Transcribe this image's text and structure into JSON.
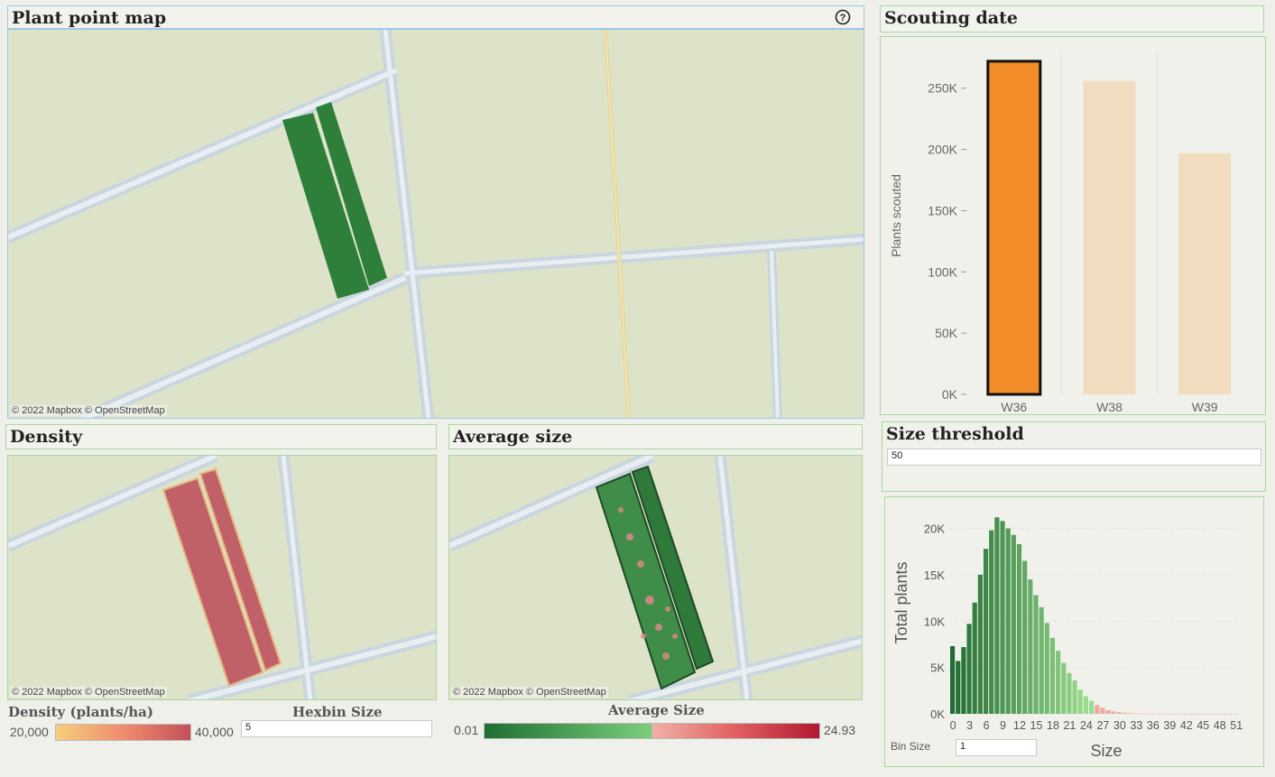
{
  "plant_map": {
    "title": "Plant point map",
    "help_icon": "question-circle-icon",
    "credit": "© 2022 Mapbox © OpenStreetMap"
  },
  "density": {
    "title": "Density",
    "credit": "© 2022 Mapbox © OpenStreetMap",
    "legend_title": "Density (plants/ha)",
    "legend_min": "20,000",
    "legend_max": "40,000",
    "hexbin_label": "Hexbin Size",
    "hexbin_value": "5"
  },
  "average_size": {
    "title": "Average size",
    "credit": "© 2022 Mapbox © OpenStreetMap",
    "legend_title": "Average Size",
    "legend_min": "0.01",
    "legend_max": "24.93"
  },
  "scouting": {
    "title": "Scouting date",
    "chart_data": {
      "type": "bar",
      "categories": [
        "W36",
        "W38",
        "W39"
      ],
      "values": [
        272000,
        256000,
        197000
      ],
      "ylabel": "Plants scouted",
      "xlabel": "",
      "ylim": [
        0,
        280000
      ],
      "yticks": [
        0,
        50000,
        100000,
        150000,
        200000,
        250000
      ],
      "ytick_labels": [
        "0K",
        "50K",
        "100K",
        "150K",
        "200K",
        "250K"
      ],
      "selected": "W36",
      "colors": {
        "selected": "#f28c28",
        "unselected": "#f1dcc0"
      }
    }
  },
  "threshold": {
    "title": "Size threshold",
    "value": "50"
  },
  "histogram": {
    "bin_size_label": "Bin Size",
    "bin_size_value": "1",
    "chart_data": {
      "type": "bar",
      "xlabel": "Size",
      "ylabel": "Total plants",
      "x": [
        0,
        1,
        2,
        3,
        4,
        5,
        6,
        7,
        8,
        9,
        10,
        11,
        12,
        13,
        14,
        15,
        16,
        17,
        18,
        19,
        20,
        21,
        22,
        23,
        24,
        25,
        26,
        27,
        28,
        29,
        30,
        31,
        32,
        33,
        34,
        35,
        36,
        37,
        38,
        39,
        40,
        41,
        42,
        43,
        44,
        45,
        46,
        47,
        48,
        49,
        50,
        51
      ],
      "values": [
        7300,
        5700,
        7200,
        9700,
        12000,
        15000,
        17800,
        19800,
        21200,
        20800,
        20000,
        19300,
        18300,
        16500,
        14500,
        12800,
        11500,
        9800,
        8200,
        6800,
        5500,
        4400,
        3600,
        2600,
        1900,
        1400,
        950,
        650,
        400,
        250,
        180,
        120,
        80,
        50,
        30,
        20,
        15,
        10,
        8,
        6,
        5,
        4,
        3,
        2,
        2,
        1,
        1,
        1,
        1,
        1,
        1,
        1
      ],
      "xticks": [
        0,
        3,
        6,
        9,
        12,
        15,
        18,
        21,
        24,
        27,
        30,
        33,
        36,
        39,
        42,
        45,
        48,
        51
      ],
      "xtick_labels": [
        "0",
        "3",
        "6",
        "9",
        "12",
        "15",
        "18",
        "21",
        "24",
        "27",
        "30",
        "33",
        "36",
        "39",
        "42",
        "45",
        "48",
        "51"
      ],
      "yticks": [
        0,
        5000,
        10000,
        15000,
        20000
      ],
      "ytick_labels": [
        "0K",
        "5K",
        "10K",
        "15K",
        "20K"
      ],
      "ylim": [
        0,
        22000
      ],
      "threshold": 50
    }
  }
}
